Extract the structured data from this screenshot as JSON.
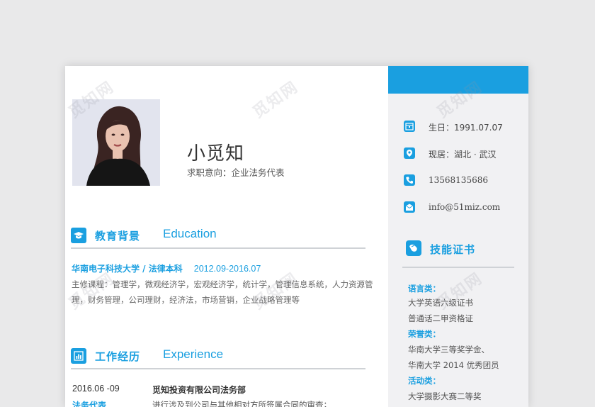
{
  "header": {
    "name": "小觅知",
    "intent": "求职意向：企业法务代表"
  },
  "contact": [
    {
      "icon": "calendar-icon",
      "text": "生日：1991.07.07"
    },
    {
      "icon": "location-icon",
      "text": "现居：湖北 · 武汉"
    },
    {
      "icon": "phone-icon",
      "text": "13568135686"
    },
    {
      "icon": "email-icon",
      "text": "info@51miz.com"
    }
  ],
  "education": {
    "title_cn": "教育背景",
    "title_en": "Education",
    "school": "华南电子科技大学 / 法律本科",
    "date": "2012.09-2016.07",
    "courses": "主修课程：管理学，微观经济学，宏观经济学，统计学，管理信息系统，人力资源管理，财务管理，公司理财，经济法，市场营销，企业战略管理等"
  },
  "work": {
    "title_cn": "工作经历",
    "title_en": "Experience",
    "date": "2016.06 -09",
    "company": "觅知投资有限公司法务部",
    "position": "法务代表",
    "desc": "进行涉及到公司与其他相对方所签属合同的审查；"
  },
  "skills": {
    "title": "技能证书",
    "groups": [
      {
        "category": "语言类：",
        "items": [
          "大学英语六级证书",
          "普通话二甲资格证"
        ]
      },
      {
        "category": "荣誉类：",
        "items": [
          "华南大学三等奖学金、",
          "华南大学 2014 优秀团员"
        ]
      },
      {
        "category": "活动类：",
        "items": [
          "大学摄影大赛二等奖"
        ]
      }
    ]
  },
  "watermark": "觅知网",
  "colors": {
    "accent": "#1a9fe0",
    "sidebar": "#f1f1f3",
    "background": "#e9e9ea"
  }
}
